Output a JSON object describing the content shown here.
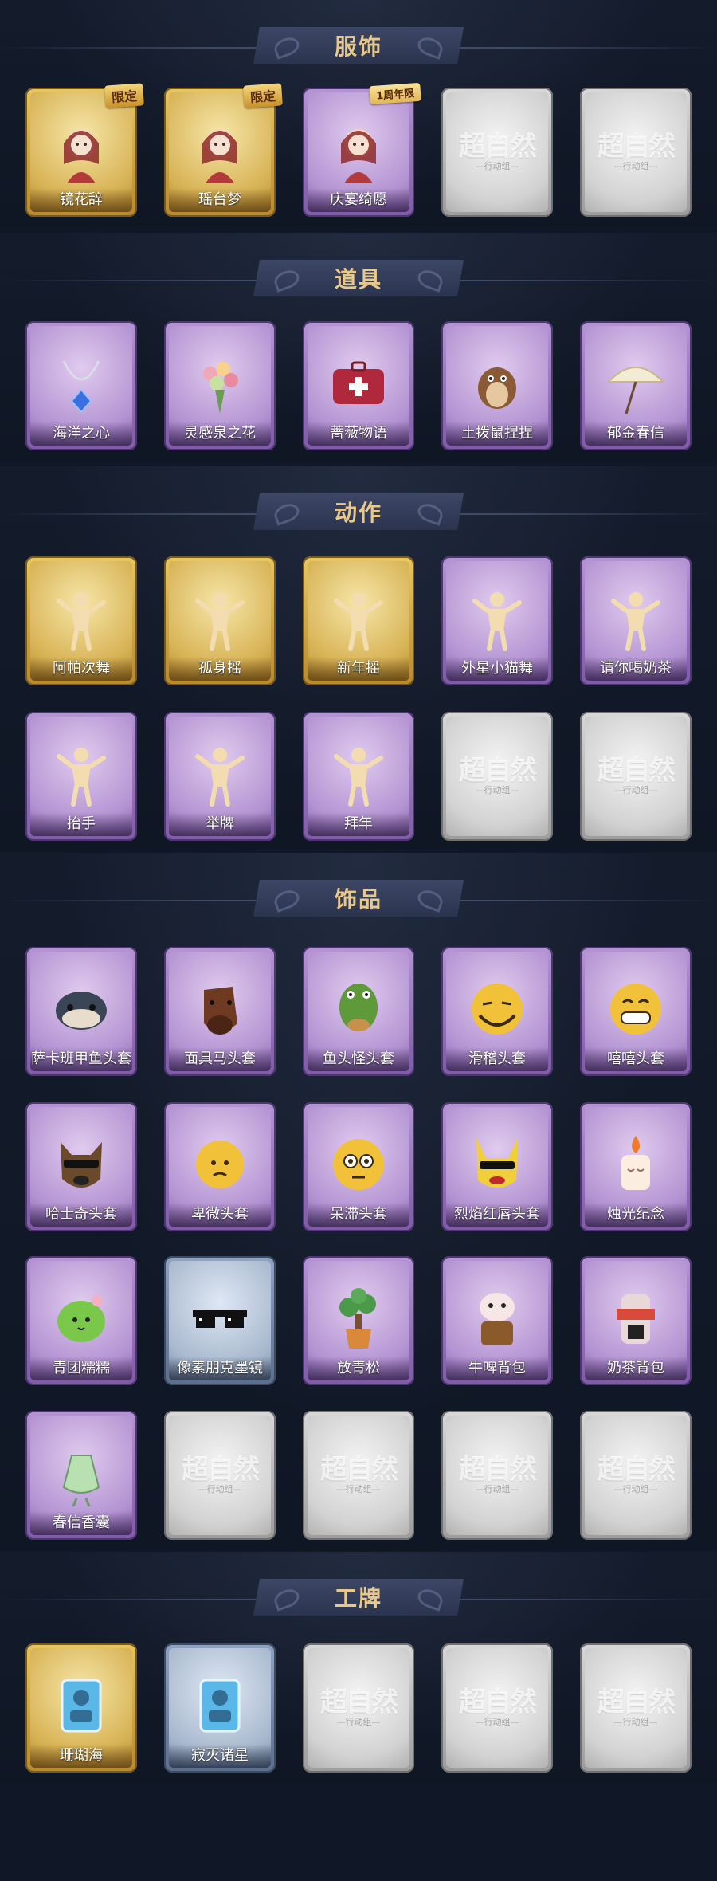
{
  "sections": [
    {
      "title": "服饰",
      "items": [
        {
          "label": "镜花辞",
          "tier": "gold",
          "tag": "限定",
          "icon": "character-portrait-icon"
        },
        {
          "label": "瑶台梦",
          "tier": "gold",
          "tag": "限定",
          "icon": "character-portrait-icon"
        },
        {
          "label": "庆宴绮愿",
          "tier": "purple",
          "tag": "1周年限",
          "icon": "character-portrait-icon"
        },
        {
          "label": "",
          "tier": "grey",
          "icon": "placeholder-logo-icon"
        },
        {
          "label": "",
          "tier": "grey",
          "icon": "placeholder-logo-icon"
        }
      ]
    },
    {
      "title": "道具",
      "items": [
        {
          "label": "海洋之心",
          "tier": "purple",
          "icon": "necklace-icon"
        },
        {
          "label": "灵感泉之花",
          "tier": "purple",
          "icon": "flower-bouquet-icon"
        },
        {
          "label": "蔷薇物语",
          "tier": "purple",
          "icon": "medical-box-icon"
        },
        {
          "label": "土拨鼠捏捏",
          "tier": "purple",
          "icon": "groundhog-icon"
        },
        {
          "label": "郁金春信",
          "tier": "purple",
          "icon": "umbrella-icon"
        }
      ]
    },
    {
      "title": "动作",
      "items": [
        {
          "label": "阿帕次舞",
          "tier": "gold",
          "icon": "dance-pose-icon"
        },
        {
          "label": "孤身摇",
          "tier": "gold",
          "icon": "dance-pose-icon"
        },
        {
          "label": "新年摇",
          "tier": "gold",
          "icon": "dance-pose-icon"
        },
        {
          "label": "外星小猫舞",
          "tier": "purple",
          "icon": "dance-pose-icon"
        },
        {
          "label": "请你喝奶茶",
          "tier": "purple",
          "icon": "dance-pose-icon"
        },
        {
          "label": "抬手",
          "tier": "purple",
          "icon": "dance-pose-icon"
        },
        {
          "label": "举牌",
          "tier": "purple",
          "icon": "dance-pose-icon"
        },
        {
          "label": "拜年",
          "tier": "purple",
          "icon": "dance-pose-icon"
        },
        {
          "label": "",
          "tier": "grey",
          "icon": "placeholder-logo-icon"
        },
        {
          "label": "",
          "tier": "grey",
          "icon": "placeholder-logo-icon"
        }
      ]
    },
    {
      "title": "饰品",
      "items": [
        {
          "label": "萨卡班甲鱼头套",
          "tier": "purple",
          "icon": "fish-head-icon"
        },
        {
          "label": "面具马头套",
          "tier": "purple",
          "icon": "horse-head-icon"
        },
        {
          "label": "鱼头怪头套",
          "tier": "purple",
          "icon": "fish-monster-head-icon"
        },
        {
          "label": "滑稽头套",
          "tier": "purple",
          "icon": "funny-face-icon"
        },
        {
          "label": "嘻嘻头套",
          "tier": "purple",
          "icon": "grin-face-icon"
        },
        {
          "label": "哈士奇头套",
          "tier": "purple",
          "icon": "husky-head-icon"
        },
        {
          "label": "卑微头套",
          "tier": "purple",
          "icon": "humble-face-icon"
        },
        {
          "label": "呆滞头套",
          "tier": "purple",
          "icon": "dazed-face-icon"
        },
        {
          "label": "烈焰红唇头套",
          "tier": "purple",
          "icon": "pikachu-head-icon"
        },
        {
          "label": "烛光纪念",
          "tier": "purple",
          "icon": "candle-icon"
        },
        {
          "label": "青团糯糯",
          "tier": "purple",
          "icon": "green-dumpling-icon"
        },
        {
          "label": "像素朋克墨镜",
          "tier": "blue",
          "icon": "pixel-sunglasses-icon"
        },
        {
          "label": "放青松",
          "tier": "purple",
          "icon": "pine-tree-icon"
        },
        {
          "label": "牛啤背包",
          "tier": "purple",
          "icon": "cow-backpack-icon"
        },
        {
          "label": "奶茶背包",
          "tier": "purple",
          "icon": "milk-tea-backpack-icon"
        },
        {
          "label": "春信香囊",
          "tier": "purple",
          "icon": "sachet-icon"
        },
        {
          "label": "",
          "tier": "grey",
          "icon": "placeholder-logo-icon"
        },
        {
          "label": "",
          "tier": "grey",
          "icon": "placeholder-logo-icon"
        },
        {
          "label": "",
          "tier": "grey",
          "icon": "placeholder-logo-icon"
        },
        {
          "label": "",
          "tier": "grey",
          "icon": "placeholder-logo-icon"
        }
      ]
    },
    {
      "title": "工牌",
      "items": [
        {
          "label": "珊瑚海",
          "tier": "gold",
          "icon": "badge-card-icon"
        },
        {
          "label": "寂灭诸星",
          "tier": "blue",
          "icon": "badge-card-icon"
        },
        {
          "label": "",
          "tier": "grey",
          "icon": "placeholder-logo-icon"
        },
        {
          "label": "",
          "tier": "grey",
          "icon": "placeholder-logo-icon"
        },
        {
          "label": "",
          "tier": "grey",
          "icon": "placeholder-logo-icon"
        }
      ]
    }
  ],
  "placeholder": {
    "logo_text": "超自然",
    "logo_sub": "—行动组—"
  },
  "colors": {
    "background": "#101726",
    "banner": "#343d5a",
    "banner_text": "#e9c98a",
    "gold": "#d7b254",
    "purple": "#b393d2",
    "blue": "#a8b8ce",
    "grey": "#d2d2d2"
  }
}
